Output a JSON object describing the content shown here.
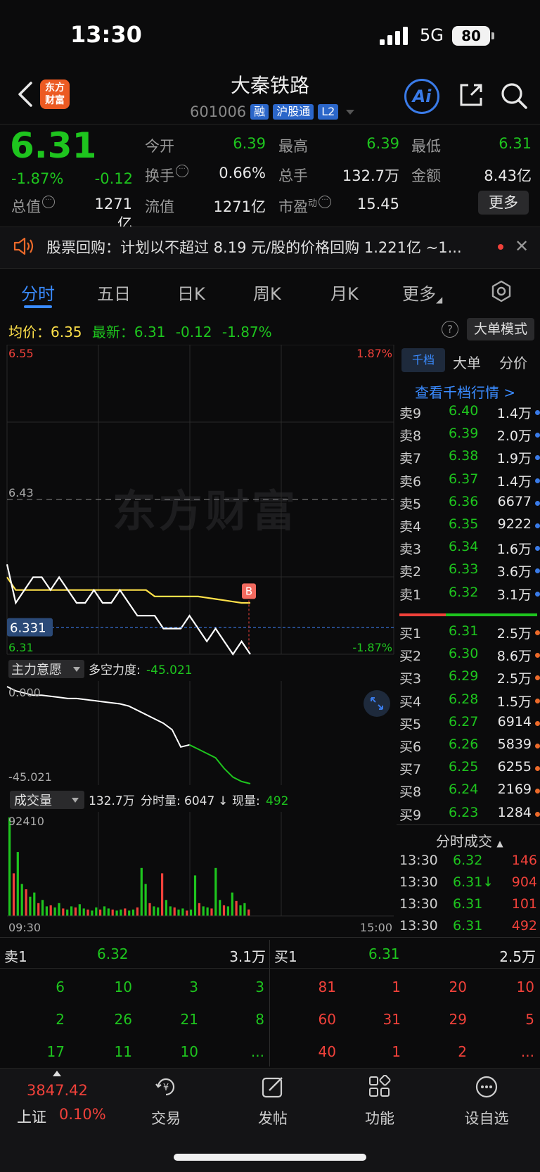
{
  "status": {
    "time": "13:30",
    "network": "5G",
    "battery": "80"
  },
  "header": {
    "logo": "东方财富",
    "title": "大秦铁路",
    "code": "601006",
    "tags": [
      "融",
      "沪股通",
      "L2"
    ],
    "ai_label": "Ai"
  },
  "quote": {
    "price": "6.31",
    "change_pct": "-1.87%",
    "change_val": "-0.12",
    "mktcap_label": "总值",
    "mktcap": "1271亿",
    "open_label": "今开",
    "open": "6.39",
    "high_label": "最高",
    "high": "6.39",
    "low_label": "最低",
    "low": "6.31",
    "turnover_label": "换手",
    "turnover": "0.66%",
    "volume_label": "总手",
    "volume": "132.7万",
    "amount_label": "金额",
    "amount": "8.43亿",
    "float_label": "流值",
    "float_cap": "1271亿",
    "pe_label": "市盈",
    "pe_sup": "动",
    "pe": "15.45",
    "more_label": "更多"
  },
  "notice": {
    "text": "股票回购：计划以不超过 8.19 元/股的价格回购 1.221亿 ~1..."
  },
  "tabs": [
    "分时",
    "五日",
    "日K",
    "周K",
    "月K",
    "更多"
  ],
  "info": {
    "avg_label": "均价：",
    "avg": "6.35",
    "latest_label": "最新：",
    "latest": "6.31",
    "latest_chg": "-0.12",
    "latest_pct": "-1.87%",
    "help": "?",
    "big_mode": "大单模式"
  },
  "chart": {
    "y_top": "6.55",
    "y_top_pct": "1.87%",
    "y_mid": "6.43",
    "y_bottom": "6.31",
    "y_bottom_pct": "-1.87%",
    "cursor_price": "6.331",
    "b_marker": "B",
    "watermark": "东方财富",
    "line_colors": {
      "price": "#ffffff",
      "avg": "#ffe14a",
      "cursor": "#3a7be8"
    }
  },
  "chart_data": [
    {
      "type": "line",
      "title": "",
      "xlabel": "",
      "ylabel": "",
      "ylim": [
        6.31,
        6.55
      ],
      "x_range": [
        "09:30",
        "15:00"
      ],
      "series": [
        {
          "name": "",
          "values": [
            6.38,
            6.35,
            6.36,
            6.37,
            6.37,
            6.36,
            6.37,
            6.36,
            6.35,
            6.35,
            6.36,
            6.35,
            6.35,
            6.36,
            6.35,
            6.34,
            6.34,
            6.34,
            6.33,
            6.33,
            6.33,
            6.34,
            6.33,
            6.32,
            6.33,
            6.32,
            6.31,
            6.32,
            6.31
          ]
        },
        {
          "name": "均价",
          "values": [
            6.37,
            6.36,
            6.36,
            6.36,
            6.36,
            6.36,
            6.36,
            6.36,
            6.36,
            6.36,
            6.36,
            6.36,
            6.36,
            6.36,
            6.36,
            6.36,
            6.36,
            6.355,
            6.355,
            6.355,
            6.355,
            6.355,
            6.355,
            6.354,
            6.353,
            6.352,
            6.351,
            6.35,
            6.35
          ]
        }
      ]
    },
    {
      "type": "line",
      "title": "主力意愿",
      "ylim": [
        -45.021,
        0.0
      ],
      "series": [
        {
          "name": "多空力度",
          "values": [
            0.0,
            -2,
            -3,
            -4,
            -4,
            -4.5,
            -5,
            -5.5,
            -5.5,
            -6,
            -6.5,
            -7,
            -7.5,
            -8,
            -9,
            -11,
            -13,
            -15,
            -17,
            -20,
            -28,
            -27,
            -29,
            -31,
            -33,
            -38,
            -42,
            -44,
            -45.021
          ]
        }
      ]
    },
    {
      "type": "bar",
      "title": "成交量",
      "ylim": [
        0,
        92410
      ],
      "x_range": [
        "09:30",
        "15:00"
      ],
      "series": [
        {
          "name": "成交量",
          "values": [
            92410,
            40000,
            60000,
            30000,
            25000,
            18000,
            22000,
            12000,
            15000,
            9000,
            10000,
            8000,
            12000,
            7000,
            6000,
            9000,
            8000,
            11000,
            7000,
            6000,
            5000,
            8000,
            6000,
            9000,
            7000,
            6000,
            5000,
            6000,
            7000,
            5000,
            6000,
            8000,
            45000,
            30000,
            12000,
            9000,
            8000,
            40000,
            15000,
            9000,
            8000,
            6000,
            7000,
            5000,
            6000,
            38000,
            12000,
            9000,
            8000,
            7000,
            45000,
            15000,
            10000,
            9000,
            22000,
            14000,
            10000,
            12000,
            6047
          ]
        }
      ],
      "summary_texts": {
        "volume_title": "成交量",
        "total": "132.7万",
        "period_label": "分时量:",
        "period": "6047",
        "arrow": "↓",
        "current_label": "现量:",
        "current": "492"
      }
    }
  ],
  "strength": {
    "title": "主力意愿",
    "label": "多空力度:",
    "value": "-45.021",
    "top": "0.000",
    "bottom": "-45.021"
  },
  "volume": {
    "title": "成交量",
    "total": "132.7万",
    "period_label": "分时量:",
    "period": "6047",
    "arrow": "↓",
    "current_label": "现量:",
    "current": "492",
    "max": "92410",
    "x_start": "09:30",
    "x_end": "15:00"
  },
  "orderbook": {
    "tabs": [
      "千档",
      "大单",
      "分价"
    ],
    "link": "查看千档行情 >",
    "sells": [
      {
        "label": "卖9",
        "price": "6.40",
        "vol": "1.4万"
      },
      {
        "label": "卖8",
        "price": "6.39",
        "vol": "2.0万"
      },
      {
        "label": "卖7",
        "price": "6.38",
        "vol": "1.9万"
      },
      {
        "label": "卖6",
        "price": "6.37",
        "vol": "1.4万"
      },
      {
        "label": "卖5",
        "price": "6.36",
        "vol": "6677"
      },
      {
        "label": "卖4",
        "price": "6.35",
        "vol": "9222"
      },
      {
        "label": "卖3",
        "price": "6.34",
        "vol": "1.6万"
      },
      {
        "label": "卖2",
        "price": "6.33",
        "vol": "3.6万"
      },
      {
        "label": "卖1",
        "price": "6.32",
        "vol": "3.1万"
      }
    ],
    "buys": [
      {
        "label": "买1",
        "price": "6.31",
        "vol": "2.5万"
      },
      {
        "label": "买2",
        "price": "6.30",
        "vol": "8.6万"
      },
      {
        "label": "买3",
        "price": "6.29",
        "vol": "2.5万"
      },
      {
        "label": "买4",
        "price": "6.28",
        "vol": "1.5万"
      },
      {
        "label": "买5",
        "price": "6.27",
        "vol": "6914"
      },
      {
        "label": "买6",
        "price": "6.26",
        "vol": "5839"
      },
      {
        "label": "买7",
        "price": "6.25",
        "vol": "6255"
      },
      {
        "label": "买8",
        "price": "6.24",
        "vol": "2169"
      },
      {
        "label": "买9",
        "price": "6.23",
        "vol": "1284"
      }
    ],
    "trades_title": "分时成交",
    "trades": [
      {
        "time": "13:30",
        "price": "6.32",
        "vol": "146"
      },
      {
        "time": "13:30",
        "price": "6.31↓",
        "vol": "904"
      },
      {
        "time": "13:30",
        "price": "6.31",
        "vol": "101"
      },
      {
        "time": "13:30",
        "price": "6.31",
        "vol": "492"
      }
    ]
  },
  "summary": {
    "sell_label": "卖1",
    "sell_price": "6.32",
    "sell_vol": "3.1万",
    "buy_label": "买1",
    "buy_price": "6.31",
    "buy_vol": "2.5万",
    "sell_cells": [
      [
        "6",
        "10",
        "3",
        "3"
      ],
      [
        "2",
        "26",
        "21",
        "8"
      ],
      [
        "17",
        "11",
        "10",
        "..."
      ]
    ],
    "buy_cells": [
      [
        "81",
        "1",
        "20",
        "10"
      ],
      [
        "60",
        "31",
        "29",
        "5"
      ],
      [
        "40",
        "1",
        "2",
        "..."
      ]
    ]
  },
  "tabbar": {
    "index_value": "3847.42",
    "index_name": "上证",
    "index_pct": "0.10%",
    "items": [
      "交易",
      "发帖",
      "功能",
      "设自选"
    ]
  }
}
